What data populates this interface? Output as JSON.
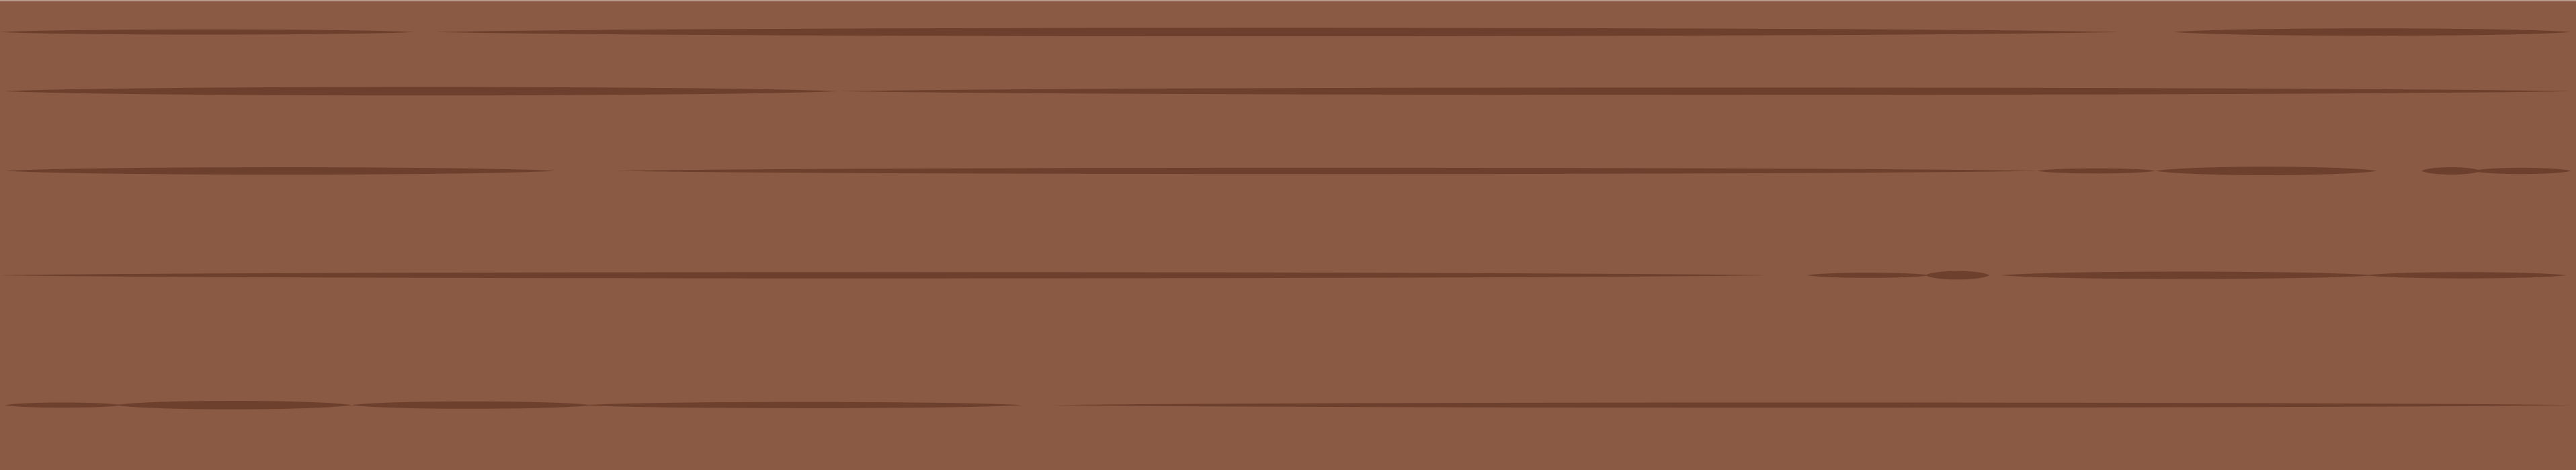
{
  "colors": {
    "wood": "#8b5a44",
    "grain": "#6d402e",
    "edge": "#b89a8c"
  }
}
